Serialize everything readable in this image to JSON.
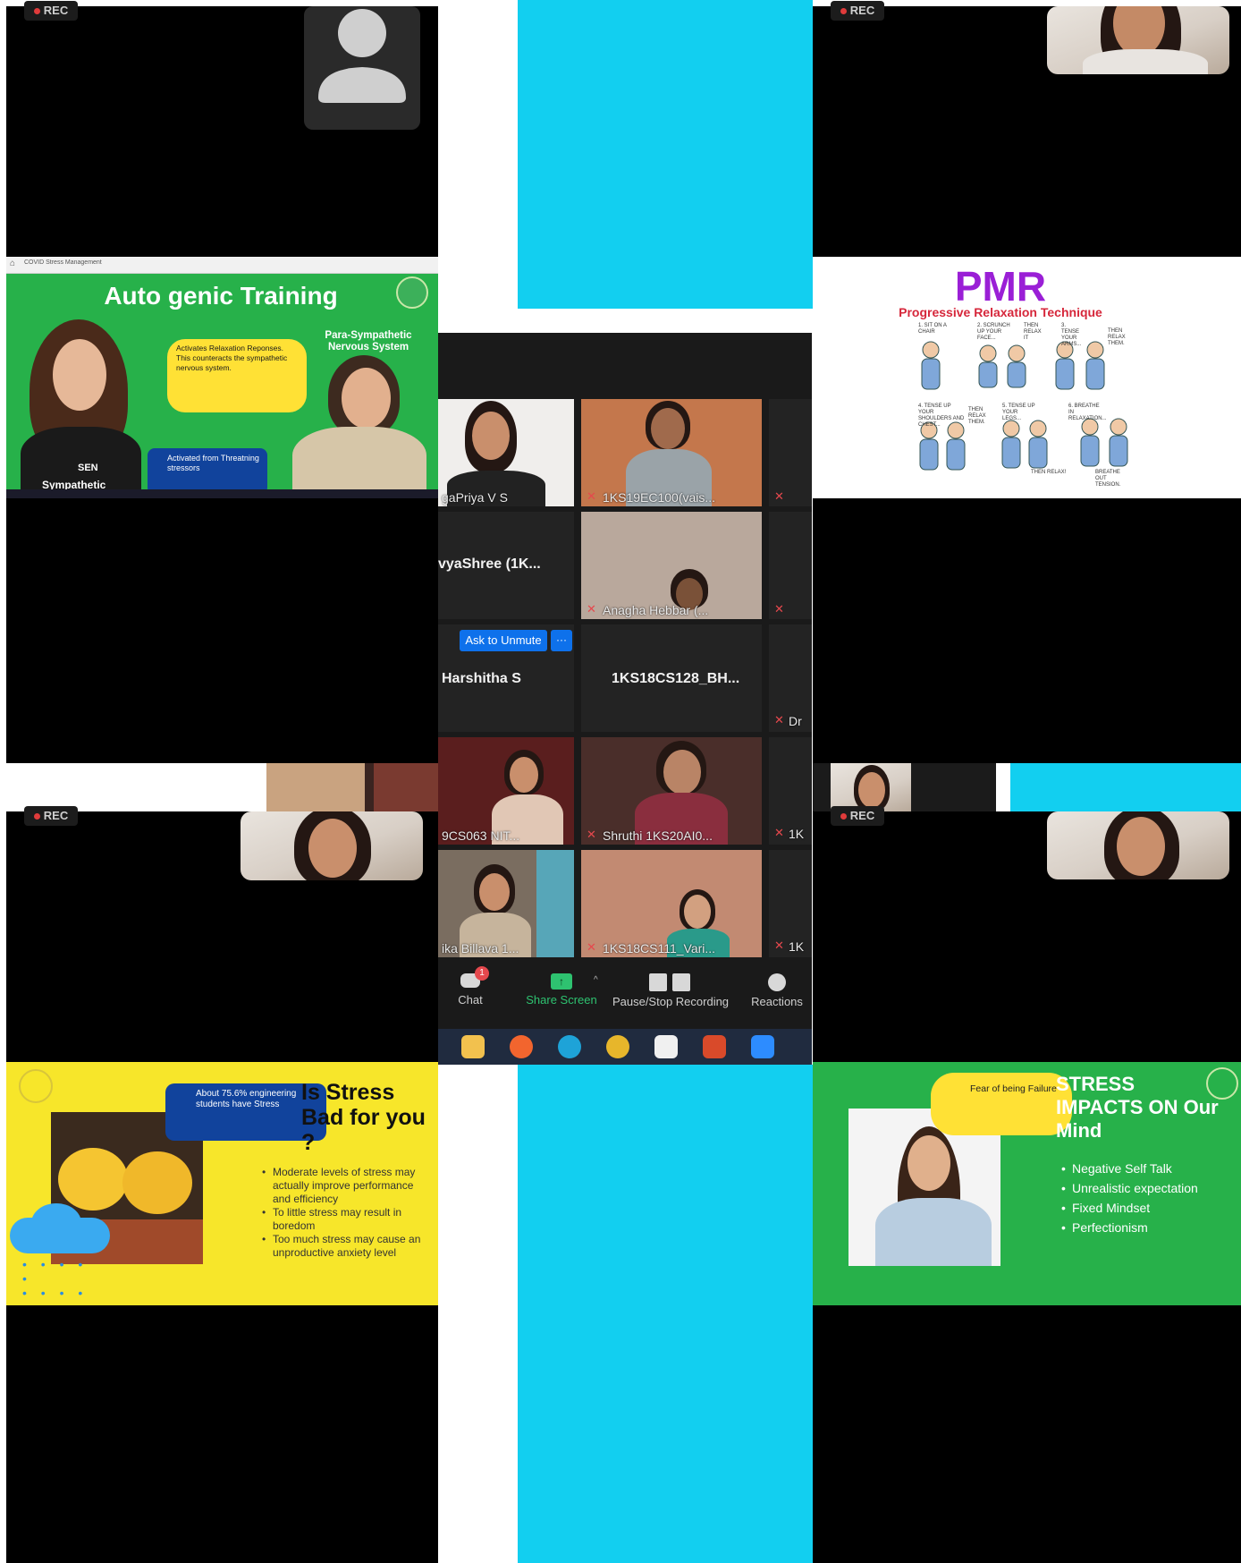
{
  "rec_badge": "REC",
  "autogenic": {
    "title": "Auto genic Training",
    "bubble_text": "Activates Relaxation Reponses. This counteracts the sympathetic nervous system.",
    "parasympathetic_label": "Para-Sympathetic Nervous System",
    "threat_box": "Activated from Threatning stressors",
    "sympathetic_label": "Sympathetic",
    "tab_label": "COVID Stress Management",
    "shirt_text": "SEN"
  },
  "pmr": {
    "title": "PMR",
    "subtitle": "Progressive Relaxation Technique",
    "steps": [
      "1. SIT ON A CHAIR",
      "2. SCRUNCH UP YOUR FACE...",
      "THEN RELAX IT",
      "3. TENSE YOUR ARMS...",
      "THEN RELAX THEM.",
      "4. TENSE UP YOUR SHOULDERS AND CHEST...",
      "THEN RELAX THEM.",
      "5. TENSE UP YOUR LEGS...",
      "6. BREATHE IN RELAXATION...",
      "THEN RELAX!",
      "BREATHE OUT TENSION."
    ]
  },
  "stress_bad": {
    "bubble_text": "About 75.6% engineering students have Stress",
    "title": "Is Stress Bad for you ?",
    "bullets": [
      "Moderate levels of stress may actually improve performance and efficiency",
      "To little stress may result in boredom",
      "Too much stress may cause an unproductive anxiety level"
    ]
  },
  "stress_mind": {
    "bubble_text": "Fear of being Failure",
    "title": "STRESS IMPACTS ON Our Mind",
    "bullets": [
      "Negative Self Talk",
      "Unrealistic expectation",
      "Fixed Mindset",
      "Perfectionism"
    ]
  },
  "zoom": {
    "tiles": [
      {
        "name": "gaPriya V S"
      },
      {
        "name": "1KS19EC100(vais..."
      },
      {
        "name": "vyaShree  (1K..."
      },
      {
        "name": "Anagha Hebbar (..."
      },
      {
        "name": "Harshitha S"
      },
      {
        "name": "1KS18CS128_BH..."
      },
      {
        "name": "9CS063 NIT..."
      },
      {
        "name": "Shruthi 1KS20AI0..."
      },
      {
        "name": "ika Billava 1..."
      },
      {
        "name": "1KS18CS111_Vari..."
      }
    ],
    "ask_unmute": "Ask to Unmute",
    "more": "···",
    "edge_labels": [
      "Dr",
      "1K",
      "1K"
    ],
    "chat_badge": "1",
    "controls": {
      "chat": "Chat",
      "share": "Share Screen",
      "record": "Pause/Stop Recording",
      "reactions": "Reactions"
    }
  }
}
